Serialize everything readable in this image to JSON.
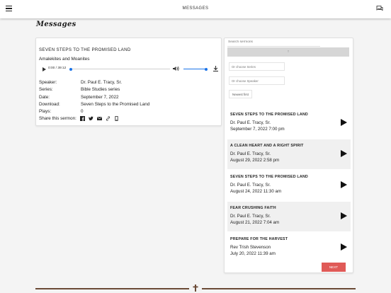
{
  "header": {
    "title": "MESSAGES",
    "menu_icon": "menu-icon",
    "chat_icon": "chat-icon"
  },
  "page": {
    "heading": "Messages"
  },
  "player": {
    "title": "SEVEN STEPS TO THE PROMISED LAND",
    "subtitle": "Amalekites and Moanites",
    "time": "0:00 / 39:12",
    "progress": 0.0,
    "volume": 1.0,
    "fields": [
      {
        "label": "Speaker:",
        "value": "Dr. Paul E. Tracy, Sr."
      },
      {
        "label": "Series:",
        "value": "Bible Studies series"
      },
      {
        "label": "Date:",
        "value": "September 7, 2022"
      },
      {
        "label": "Download:",
        "value": "Seven Steps to the Promised Land"
      },
      {
        "label": "Plays:",
        "value": "0"
      }
    ],
    "share_label": "Share this sermon:",
    "share_icons": [
      "facebook-icon",
      "twitter-icon",
      "email-icon",
      "link-icon",
      "mobile-icon"
    ]
  },
  "sidebar": {
    "search_placeholder": "Search sermons",
    "search_button": "↑",
    "series_placeholder": "Or choose Series",
    "speaker_placeholder": "Or choose Speaker",
    "sort_label": "Newest first",
    "next_label": "NEXT",
    "items": [
      {
        "title": "SEVEN STEPS TO THE PROMISED LAND",
        "speaker": "Dr. Paul E. Tracy, Sr.",
        "date": "September 7, 2022 7:00 pm"
      },
      {
        "title": "A CLEAN HEART AND A RIGHT SPIRIT",
        "speaker": "Dr. Paul E. Tracy, Sr.",
        "date": "August 29, 2022 2:58 pm"
      },
      {
        "title": "SEVEN STEPS TO THE PROMISED LAND",
        "speaker": "Dr. Paul E. Tracy, Sr.",
        "date": "August 24, 2022 11:30 am"
      },
      {
        "title": "FEAR CRUSHING FAITH",
        "speaker": "Dr. Paul E. Tracy, Sr.",
        "date": "August 21, 2022 7:04 am"
      },
      {
        "title": "PREPARE FOR THE HARVEST",
        "speaker": "Rev Trish Stevenson",
        "date": "July 20, 2022 11:39 am"
      }
    ]
  },
  "colors": {
    "accent": "#1a73e8",
    "next_button": "#e05a57",
    "divider": "#6b4a36"
  }
}
